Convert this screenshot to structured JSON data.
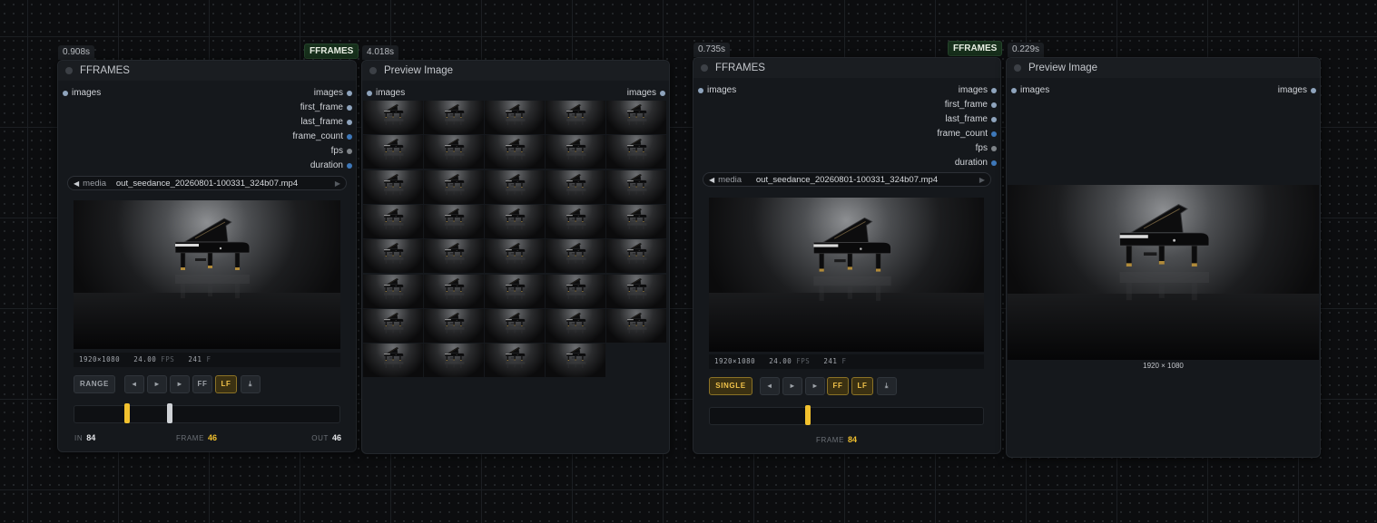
{
  "nodes": {
    "fframes_a": {
      "time": "0.908s",
      "badge": "FFRAMES",
      "title": "FFRAMES",
      "input": "images",
      "outputs": [
        "images",
        "first_frame",
        "last_frame",
        "frame_count",
        "fps",
        "duration"
      ],
      "media_label": "media",
      "media_value": "out_seedance_20260801-100331_324b07.mp4",
      "meta": {
        "resolution": "1920×1080",
        "fps": "24.00",
        "fps_unit": "FPS",
        "frames": "241",
        "frames_unit": "F"
      },
      "mode_button": "RANGE",
      "buttons": {
        "prev": "◂",
        "play": "▸",
        "next": "▸",
        "ff": "FF",
        "lf": "LF",
        "download": "⤓"
      },
      "range": {
        "in_fraction": 0.19,
        "out_fraction": 0.35
      },
      "info": {
        "in_label": "IN",
        "in_value": "84",
        "frame_label": "FRAME",
        "frame_value": "46",
        "out_label": "OUT",
        "out_value": "46"
      }
    },
    "preview_a": {
      "time": "4.018s",
      "title": "Preview Image",
      "input": "images",
      "output": "images",
      "grid": {
        "columns": 5,
        "full_rows": 7,
        "last_row": 4
      }
    },
    "fframes_b": {
      "time": "0.735s",
      "badge": "FFRAMES",
      "title": "FFRAMES",
      "input": "images",
      "outputs": [
        "images",
        "first_frame",
        "last_frame",
        "frame_count",
        "fps",
        "duration"
      ],
      "media_label": "media",
      "media_value": "out_seedance_20260801-100331_324b07.mp4",
      "meta": {
        "resolution": "1920×1080",
        "fps": "24.00",
        "fps_unit": "FPS",
        "frames": "241",
        "frames_unit": "F"
      },
      "mode_button": "SINGLE",
      "buttons": {
        "prev": "◂",
        "play": "▸",
        "next": "▸",
        "ff": "FF",
        "lf": "LF",
        "download": "⤓"
      },
      "frame_fraction": 0.35,
      "info": {
        "frame_label": "FRAME",
        "frame_value": "84"
      }
    },
    "preview_b": {
      "time": "0.229s",
      "title": "Preview Image",
      "input": "images",
      "output": "images",
      "resolution": "1920 × 1080"
    }
  },
  "icons": [
    "play-icon",
    "prev-icon",
    "next-icon",
    "download-icon",
    "media-arrow-left-icon",
    "media-arrow-right-icon"
  ]
}
